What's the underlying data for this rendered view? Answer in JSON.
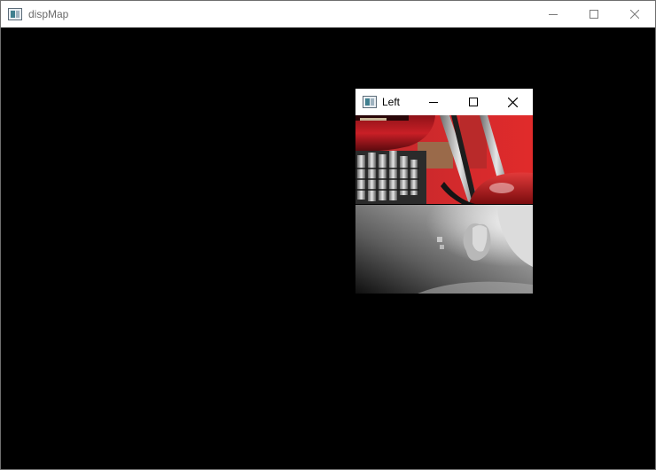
{
  "main_window": {
    "title": "dispMap",
    "icon": "app-window-icon",
    "controls": [
      "minimize",
      "maximize",
      "close"
    ]
  },
  "child_window": {
    "title": "Left",
    "icon": "app-window-icon",
    "controls": [
      "minimize",
      "maximize",
      "close"
    ],
    "images": [
      "color-photo-motorcycle",
      "disparity-map-grayscale"
    ]
  }
}
